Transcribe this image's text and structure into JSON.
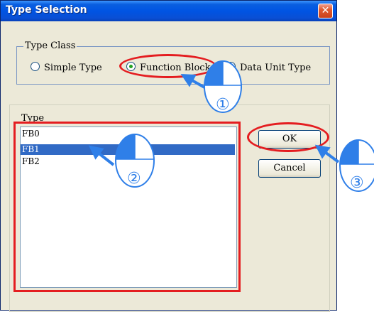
{
  "window": {
    "title": "Type Selection"
  },
  "type_class": {
    "legend": "Type Class",
    "options": [
      {
        "label": "Simple Type",
        "checked": false
      },
      {
        "label": "Function Block",
        "checked": true
      },
      {
        "label": "Data Unit Type",
        "checked": false
      }
    ]
  },
  "type_list": {
    "label": "Type",
    "items": [
      "FB0",
      "FB1",
      "FB2"
    ],
    "selected": "FB1"
  },
  "buttons": {
    "ok": "OK",
    "cancel": "Cancel"
  },
  "callouts": [
    "①",
    "②",
    "③"
  ],
  "colors": {
    "highlight": "#e41d20",
    "arrow": "#2f7fe8",
    "selection": "#316ac5"
  }
}
